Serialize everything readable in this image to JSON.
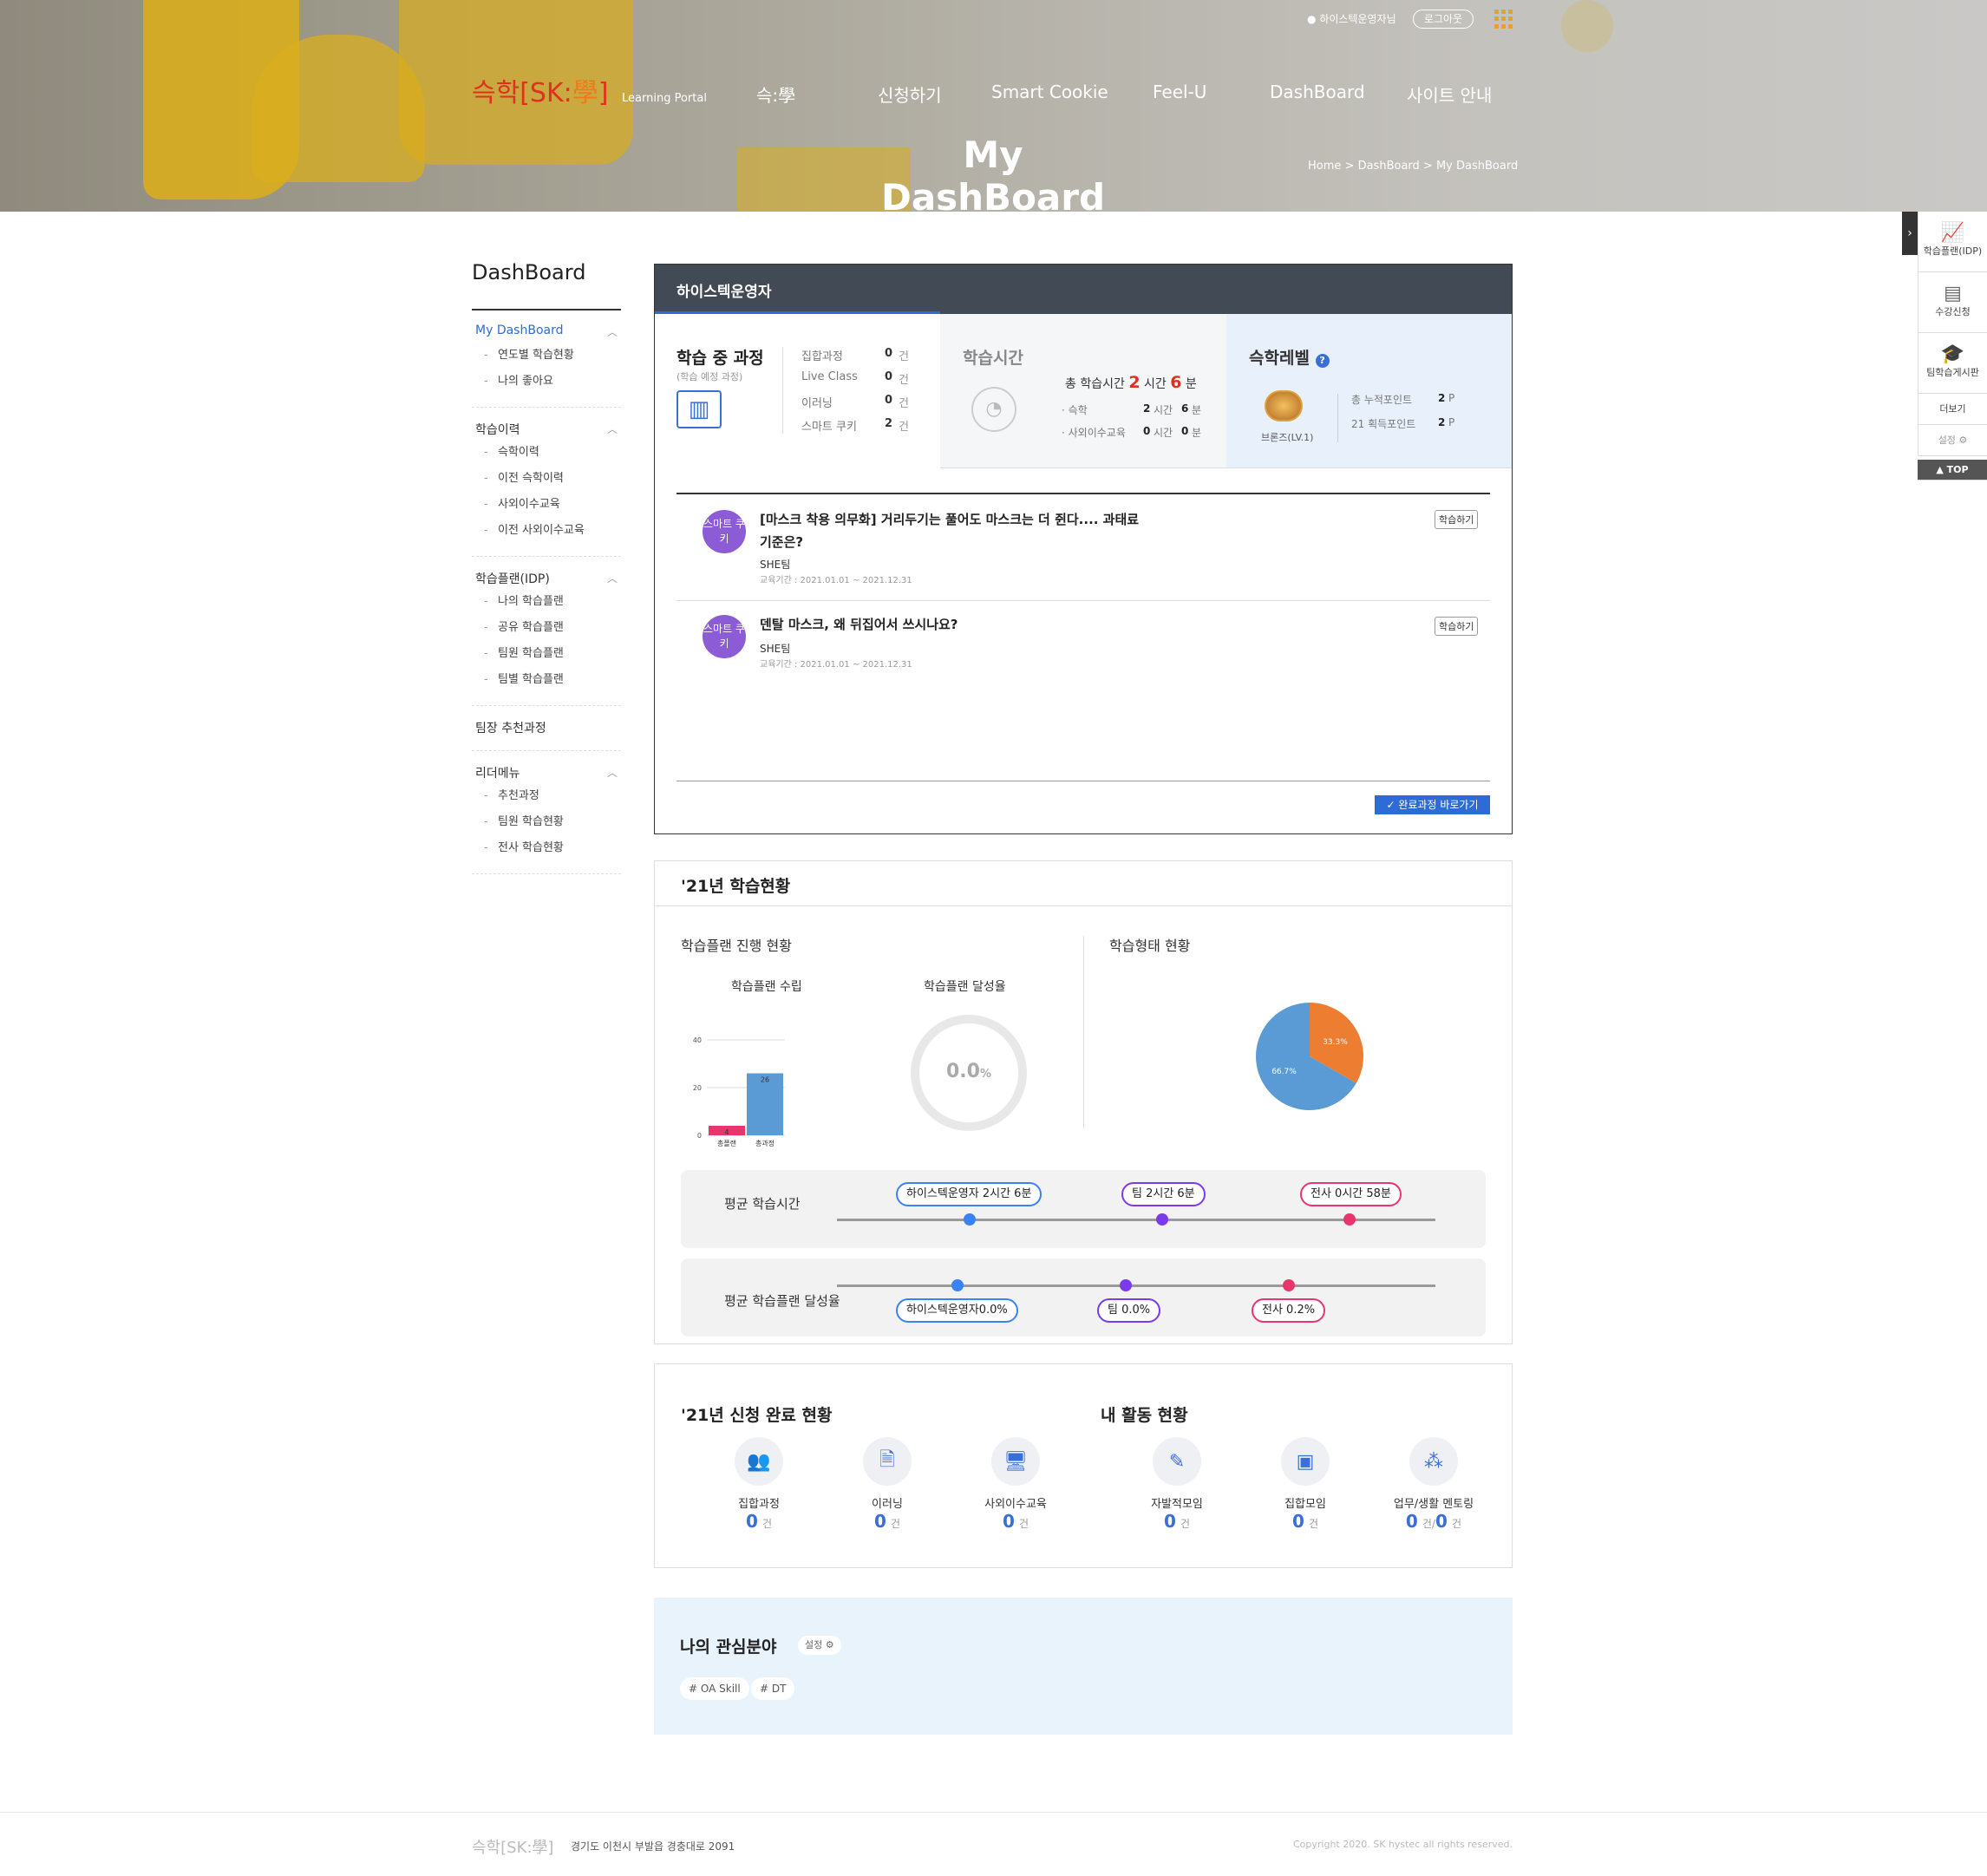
{
  "header": {
    "user_name": "하이스텍운영자님",
    "logout": "로그아웃",
    "logo_kor": "슥학",
    "logo_br_open": "[",
    "logo_sk": "SK",
    "logo_colon": ":",
    "logo_hak": "學",
    "logo_br_close": "]",
    "logo_sub": "Learning Portal",
    "nav": [
      "슥:學",
      "신청하기",
      "Smart Cookie",
      "Feel-U",
      "DashBoard",
      "사이트 안내"
    ],
    "page_title": "My DashBoard",
    "breadcrumb": [
      "Home",
      ">",
      "DashBoard",
      ">",
      "My DashBoard"
    ]
  },
  "sidebar": {
    "title": "DashBoard",
    "groups": [
      {
        "label": "My DashBoard",
        "items": [
          "연도별 학습현황",
          "나의 좋아요"
        ]
      },
      {
        "label": "학습이력",
        "items": [
          "슥학이력",
          "이전 슥학이력",
          "사외이수교육",
          "이전 사외이수교육"
        ]
      },
      {
        "label": "학습플랜(IDP)",
        "items": [
          "나의 학습플랜",
          "공유 학습플랜",
          "팀원 학습플랜",
          "팀별 학습플랜"
        ]
      },
      {
        "label": "팀장 추천과정",
        "items": []
      },
      {
        "label": "리더메뉴",
        "items": [
          "추천과정",
          "팀원 학습현황",
          "전사 학습현황"
        ]
      }
    ]
  },
  "quick": {
    "items": [
      "학습플랜(IDP)",
      "수강신청",
      "팀학습게시판",
      "더보기",
      "설정 ⚙"
    ],
    "top": "▲ TOP"
  },
  "panel": {
    "user": "하이스텍운영자",
    "courses": {
      "title": "학습 중 과정",
      "sub": "(학습 예정 과정)",
      "rows": [
        {
          "label": "집합과정",
          "count": "0",
          "unit": "건"
        },
        {
          "label": "Live Class",
          "count": "0",
          "unit": "건"
        },
        {
          "label": "이러닝",
          "count": "0",
          "unit": "건"
        },
        {
          "label": "스마트 쿠키",
          "count": "2",
          "unit": "건"
        }
      ]
    },
    "time": {
      "title": "학습시간",
      "total_label": "총 학습시간",
      "total_h": "2",
      "h_unit": "시간",
      "total_m": "6",
      "m_unit": "분",
      "rows": [
        {
          "label": "· 슥학",
          "h": "2",
          "m": "6"
        },
        {
          "label": "· 사외이수교육",
          "h": "0",
          "m": "0"
        }
      ],
      "h_unit_s": "시간",
      "m_unit_s": "분"
    },
    "level": {
      "title": "슥학레벨",
      "badge": "브론즈(LV.1)",
      "rows": [
        {
          "label": "총 누적포인트",
          "val": "2",
          "unit": "P"
        },
        {
          "label": "21 획득포인트",
          "val": "2",
          "unit": "P"
        }
      ]
    },
    "list": [
      {
        "tag": "스마트 쿠키",
        "title1": "[마스크 착용 의무화] 거리두기는 풀어도 마스크는 더 쥔다.... 과태료",
        "title2": "기준은?",
        "team": "SHE팀",
        "period": "교육기간 : 2021.01.01 ~ 2021.12.31",
        "btn": "학습하기"
      },
      {
        "tag": "스마트 쿠키",
        "title1": "덴탈 마스크, 왜 뒤집어서 쓰시나요?",
        "title2": "",
        "team": "SHE팀",
        "period": "교육기간 : 2021.01.01 ~ 2021.12.31",
        "btn": "학습하기"
      }
    ],
    "done_btn": "✓ 완료과정 바로가기"
  },
  "status": {
    "title": "'21년 학습현황",
    "plan_title": "학습플랜 진행 현황",
    "type_title": "학습형태 현황",
    "bar_title": "학습플랜 수립",
    "donut_title": "학습플랜 달성율",
    "donut_value": "0.0",
    "donut_unit": "%",
    "avg_time_label": "평균 학습시간",
    "avg_plan_label": "평균 학습플랜 달성율",
    "time_pills": [
      "하이스텍운영자 2시간 6분",
      "팀 2시간 6분",
      "전사 0시간 58분"
    ],
    "plan_pills": [
      "하이스텍운영자0.0%",
      "팀 0.0%",
      "전사 0.2%"
    ],
    "colors": {
      "blue": "#3b82f6",
      "purple": "#7c3aed",
      "pink": "#e8356d",
      "orange": "#ed7d31",
      "pie_blue": "#5b9bd5"
    }
  },
  "chart_data": [
    {
      "type": "bar",
      "categories": [
        "총플랜",
        "총과정"
      ],
      "values": [
        4,
        26
      ],
      "ylim": [
        0,
        40
      ],
      "yticks": [
        "40",
        "20",
        "0"
      ]
    },
    {
      "type": "pie",
      "labels": [
        "33.3%",
        "66.7%"
      ],
      "values": [
        33.3,
        66.7
      ]
    }
  ],
  "apply": {
    "title": "'21년 신청 완료 현황",
    "items": [
      {
        "label": "집합과정",
        "count": "0",
        "unit": "건",
        "icon": "group-icon"
      },
      {
        "label": "이러닝",
        "count": "0",
        "unit": "건",
        "icon": "document-icon"
      },
      {
        "label": "사외이수교육",
        "count": "0",
        "unit": "건",
        "icon": "monitor-icon"
      }
    ]
  },
  "activity": {
    "title": "내 활동 현황",
    "items": [
      {
        "label": "자발적모임",
        "count": "0",
        "unit": "건",
        "icon": "pen-icon"
      },
      {
        "label": "집합모임",
        "count": "0",
        "unit": "건",
        "icon": "portrait-icon"
      },
      {
        "label": "업무/생활 멘토링",
        "count": "0",
        "unit": "건/",
        "count2": "0",
        "unit2": "건",
        "icon": "team-icon"
      }
    ]
  },
  "interest": {
    "title": "나의 관심분야",
    "setting": "설정 ⚙",
    "tags": [
      "# OA Skill",
      "# DT"
    ]
  },
  "footer": {
    "logo": "슥학[SK:學]",
    "address": "경기도 이천시 부발읍 경충대로 2091",
    "copyright": "Copyright 2020. SK hystec all rights reserved."
  }
}
